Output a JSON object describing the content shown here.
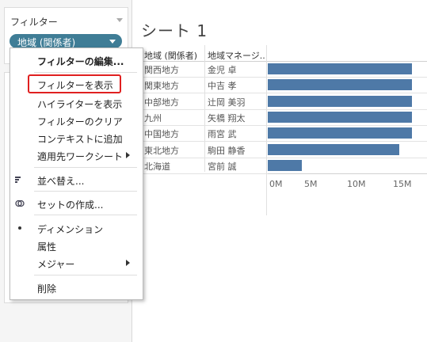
{
  "left_pane": {
    "filters_title": "フィルター",
    "filter_pill": "地域 (関係者)"
  },
  "sheet": {
    "title": "シート 1",
    "columns": [
      "地域 (関係者)",
      "地域マネージ.."
    ],
    "rows": [
      {
        "region": "関西地方",
        "manager": "金児 卓",
        "value": 17.0
      },
      {
        "region": "関東地方",
        "manager": "中吉 孝",
        "value": 17.0
      },
      {
        "region": "中部地方",
        "manager": "辻岡 美羽",
        "value": 17.0
      },
      {
        "region": "九州",
        "manager": "矢橋 翔太",
        "value": 17.0
      },
      {
        "region": "中国地方",
        "manager": "雨宮 武",
        "value": 17.0
      },
      {
        "region": "東北地方",
        "manager": "駒田 静香",
        "value": 15.5
      },
      {
        "region": "北海道",
        "manager": "宮前 誠",
        "value": 4.0
      }
    ],
    "axis_ticks": [
      "0M",
      "5M",
      "10M",
      "15M"
    ],
    "bar_color": "#4e79a7"
  },
  "context_menu": {
    "items": {
      "edit_filter": "フィルターの編集...",
      "show_filter": "フィルターを表示",
      "show_highlighter": "ハイライターを表示",
      "clear_filter": "フィルターのクリア",
      "add_to_context": "コンテキストに追加",
      "apply_to_worksheets": "適用先ワークシート",
      "sort": "並べ替え...",
      "create_set": "セットの作成...",
      "dimension": "ディメンション",
      "attribute": "属性",
      "measure": "メジャー",
      "remove": "削除"
    },
    "highlight_color": "#e02020"
  }
}
